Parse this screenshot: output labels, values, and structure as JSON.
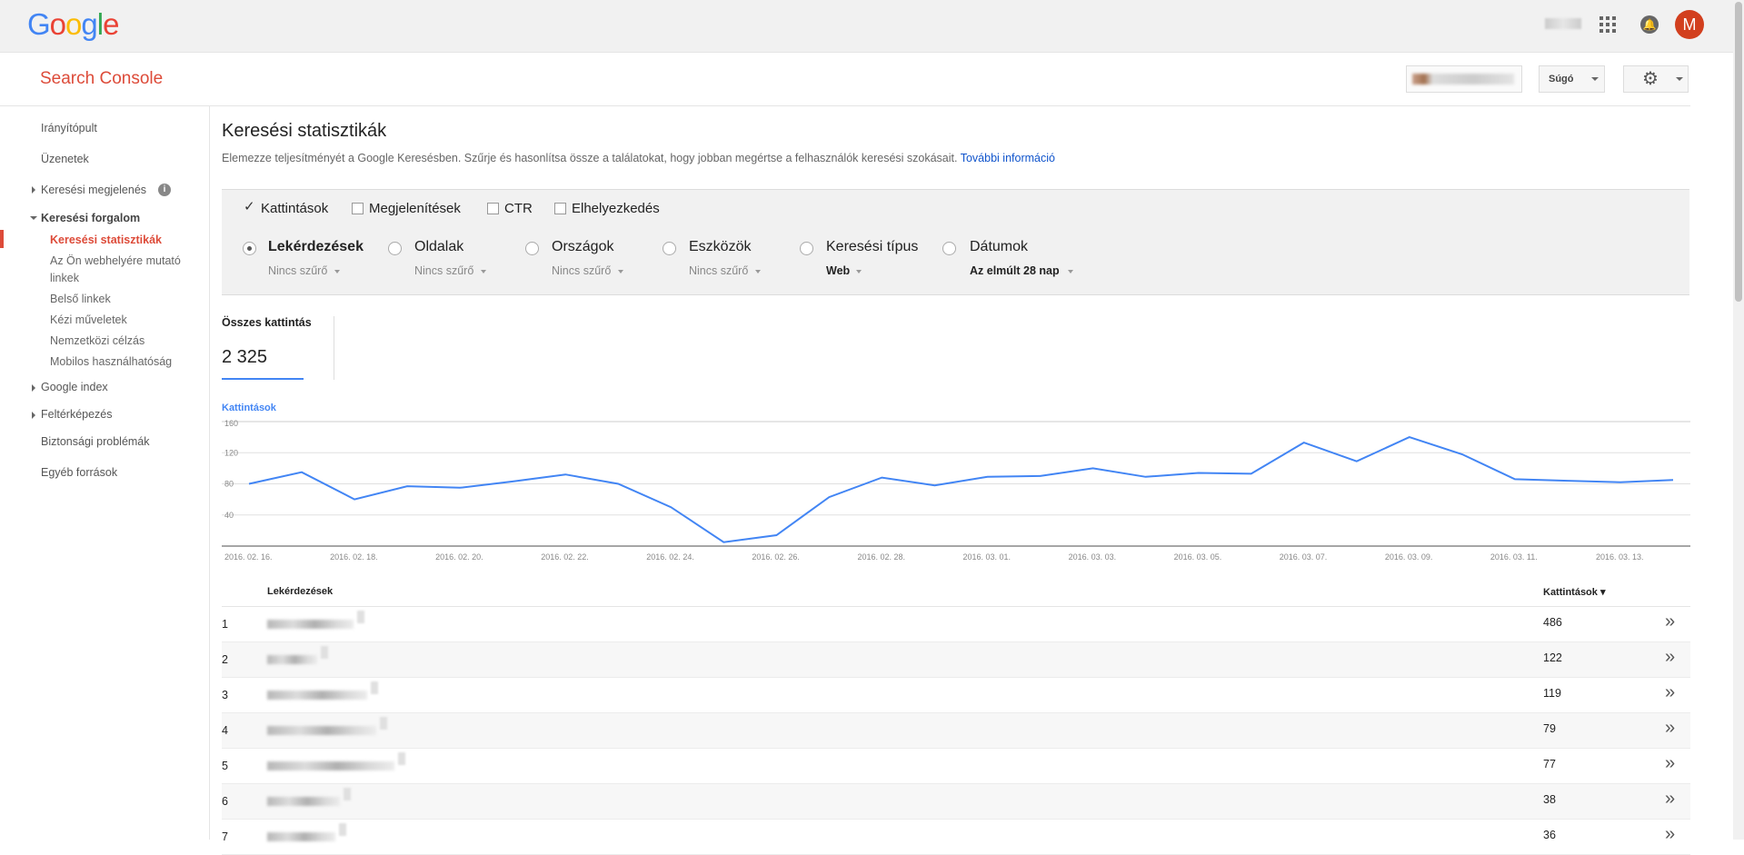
{
  "topbar": {
    "logo_letters": [
      {
        "ch": "G",
        "color": "#4285f4"
      },
      {
        "ch": "o",
        "color": "#ea4335"
      },
      {
        "ch": "o",
        "color": "#fbbc05"
      },
      {
        "ch": "g",
        "color": "#4285f4"
      },
      {
        "ch": "l",
        "color": "#34a853"
      },
      {
        "ch": "e",
        "color": "#ea4335"
      }
    ],
    "avatar_letter": "M",
    "icons": [
      "apps-icon",
      "notifications-icon"
    ]
  },
  "header": {
    "brand": "Search Console",
    "help_label": "Súgó",
    "gear_glyph": "⚙"
  },
  "sidebar": {
    "items": [
      {
        "label": "Irányítópult"
      },
      {
        "label": "Üzenetek"
      },
      {
        "label": "Keresési megjelenés"
      },
      {
        "label": "Keresési forgalom"
      },
      {
        "label": "Keresési statisztikák"
      },
      {
        "label": "Az Ön webhelyére mutató"
      },
      {
        "label": "linkek"
      },
      {
        "label": "Belső linkek"
      },
      {
        "label": "Kézi műveletek"
      },
      {
        "label": "Nemzetközi célzás"
      },
      {
        "label": "Mobilos használhatóság"
      },
      {
        "label": "Google index"
      },
      {
        "label": "Feltérképezés"
      },
      {
        "label": "Biztonsági problémák"
      },
      {
        "label": "Egyéb források"
      }
    ],
    "info_glyph": "i"
  },
  "main": {
    "title": "Keresési statisztikák",
    "description": "Elemezze teljesítményét a Google Keresésben. Szűrje és hasonlítsa össze a találatokat, hogy jobban megértse a felhasználók keresési szokásait.",
    "more_link": "További információ",
    "metrics": [
      {
        "label": "Kattintások",
        "checked": true
      },
      {
        "label": "Megjelenítések",
        "checked": false
      },
      {
        "label": "CTR",
        "checked": false
      },
      {
        "label": "Elhelyezkedés",
        "checked": false
      }
    ],
    "check_glyph": "✓",
    "dimensions": [
      {
        "label": "Lekérdezések",
        "filter": "Nincs szűrő",
        "selected": true
      },
      {
        "label": "Oldalak",
        "filter": "Nincs szűrő",
        "selected": false
      },
      {
        "label": "Országok",
        "filter": "Nincs szűrő",
        "selected": false
      },
      {
        "label": "Eszközök",
        "filter": "Nincs szűrő",
        "selected": false
      },
      {
        "label": "Keresési típus",
        "filter": "Web",
        "selected": false
      },
      {
        "label": "Dátumok",
        "filter": "Az elmúlt 28 nap",
        "selected": false
      }
    ],
    "total": {
      "label": "Összes kattintás",
      "value": "2 325"
    }
  },
  "chart_data": {
    "type": "line",
    "title": "",
    "series": [
      {
        "name": "Kattintások",
        "color": "#4285f4",
        "values": [
          80,
          95,
          60,
          77,
          75,
          83,
          92,
          80,
          50,
          5,
          14,
          63,
          88,
          78,
          89,
          90,
          100,
          89,
          94,
          93,
          133,
          109,
          140,
          118,
          86,
          84,
          82,
          85
        ]
      }
    ],
    "x": [
      "2016. 02. 16.",
      "2016. 02. 17.",
      "2016. 02. 18.",
      "2016. 02. 19.",
      "2016. 02. 20.",
      "2016. 02. 21.",
      "2016. 02. 22.",
      "2016. 02. 23.",
      "2016. 02. 24.",
      "2016. 02. 25.",
      "2016. 02. 26.",
      "2016. 02. 27.",
      "2016. 02. 28.",
      "2016. 02. 29.",
      "2016. 03. 01.",
      "2016. 03. 02.",
      "2016. 03. 03.",
      "2016. 03. 04.",
      "2016. 03. 05.",
      "2016. 03. 06.",
      "2016. 03. 07.",
      "2016. 03. 08.",
      "2016. 03. 09.",
      "2016. 03. 10.",
      "2016. 03. 11.",
      "2016. 03. 12.",
      "2016. 03. 13.",
      "2016. 03. 14."
    ],
    "xticks": [
      "2016. 02. 16.",
      "2016. 02. 18.",
      "2016. 02. 20.",
      "2016. 02. 22.",
      "2016. 02. 24.",
      "2016. 02. 26.",
      "2016. 02. 28.",
      "2016. 03. 01.",
      "2016. 03. 03.",
      "2016. 03. 05.",
      "2016. 03. 07.",
      "2016. 03. 09.",
      "2016. 03. 11.",
      "2016. 03. 13."
    ],
    "yticks": [
      160,
      120,
      80,
      40
    ],
    "ylim": [
      0,
      160
    ],
    "xlabel": "",
    "ylabel": "Kattintások",
    "grid": true,
    "legend": "none"
  },
  "table": {
    "columns": [
      "Lekérdezések",
      "Kattintások ▾"
    ],
    "rows": [
      {
        "rank": "1",
        "clicks": "486"
      },
      {
        "rank": "2",
        "clicks": "122"
      },
      {
        "rank": "3",
        "clicks": "119"
      },
      {
        "rank": "4",
        "clicks": "79"
      },
      {
        "rank": "5",
        "clicks": "77"
      },
      {
        "rank": "6",
        "clicks": "38"
      },
      {
        "rank": "7",
        "clicks": "36"
      }
    ],
    "open_glyph": "»"
  }
}
